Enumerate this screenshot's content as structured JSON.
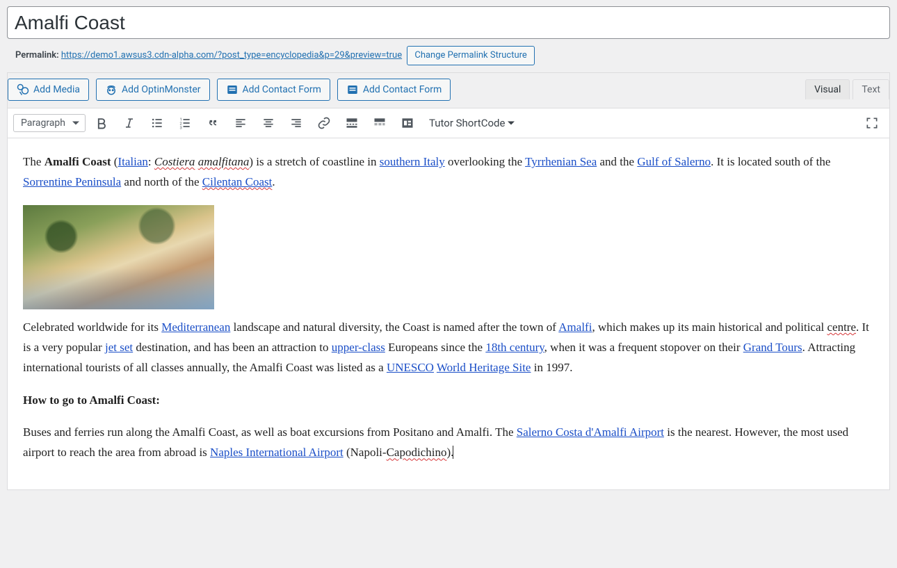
{
  "title": "Amalfi Coast",
  "permalink": {
    "label": "Permalink:",
    "url": "https://demo1.awsus3.cdn-alpha.com/?post_type=encyclopedia&p=29&preview=true",
    "change_btn": "Change Permalink Structure"
  },
  "media_buttons": {
    "add_media": "Add Media",
    "add_optin": "Add OptinMonster",
    "add_cf_1": "Add Contact Form",
    "add_cf_2": "Add Contact Form"
  },
  "tabs": {
    "visual": "Visual",
    "text": "Text"
  },
  "toolbar": {
    "format": "Paragraph",
    "tutor": "Tutor ShortCode"
  },
  "body": {
    "p1_a": "The ",
    "p1_bold": "Amalfi Coast",
    "p1_b": " (",
    "link_italian": "Italian",
    "p1_c": ": ",
    "em_costiera": "Costiera",
    "sp1": " ",
    "em_amalfitana": "amalfitana",
    "p1_d": ") is a stretch of coastline in ",
    "link_southern": "southern Italy",
    "p1_e": " overlooking the ",
    "link_tyrr": "Tyrrhenian Sea",
    "p1_f": " and the ",
    "link_gulf": "Gulf of Salerno",
    "p1_g": ". It is located south of the ",
    "link_sorr": "Sorrentine Peninsula",
    "p1_h": " and north of the ",
    "link_cilentan": "Cilentan Coast",
    "p1_i": ".",
    "p2_a": "Celebrated worldwide for its ",
    "link_med": "Mediterranean",
    "p2_b": " landscape and natural diversity, the Coast is named after the town of ",
    "link_amalfi": "Amalfi",
    "p2_c": ", which makes up its main historical and political ",
    "spell_centre": "centre",
    "p2_d": ". It is a very popular ",
    "link_jetset": "jet set",
    "p2_e": " destination, and has been an attraction to ",
    "link_upper": "upper-class",
    "p2_f": " Europeans since the ",
    "link_18th": "18th century",
    "p2_g": ", when it was a frequent stopover on their ",
    "link_grand": "Grand Tours",
    "p2_h": ". Attracting international tourists of all classes annually, the Amalfi Coast was listed as a ",
    "link_unesco": "UNESCO",
    "sp2": " ",
    "link_whs": "World Heritage Site",
    "p2_i": " in 1997.",
    "h_howto": "How to go to Amalfi Coast:",
    "p3_a": "Buses and ferries run along the Amalfi Coast, as well as boat excursions from Positano and Amalfi. The ",
    "link_salerno": "Salerno Costa d'Amalfi Airport",
    "p3_b": " is the nearest. However, the most used airport to reach the area from abroad is ",
    "link_naples": "Naples International Airport",
    "p3_c": " (Napoli-",
    "spell_capo": "Capodichino",
    "p3_d": ")."
  }
}
